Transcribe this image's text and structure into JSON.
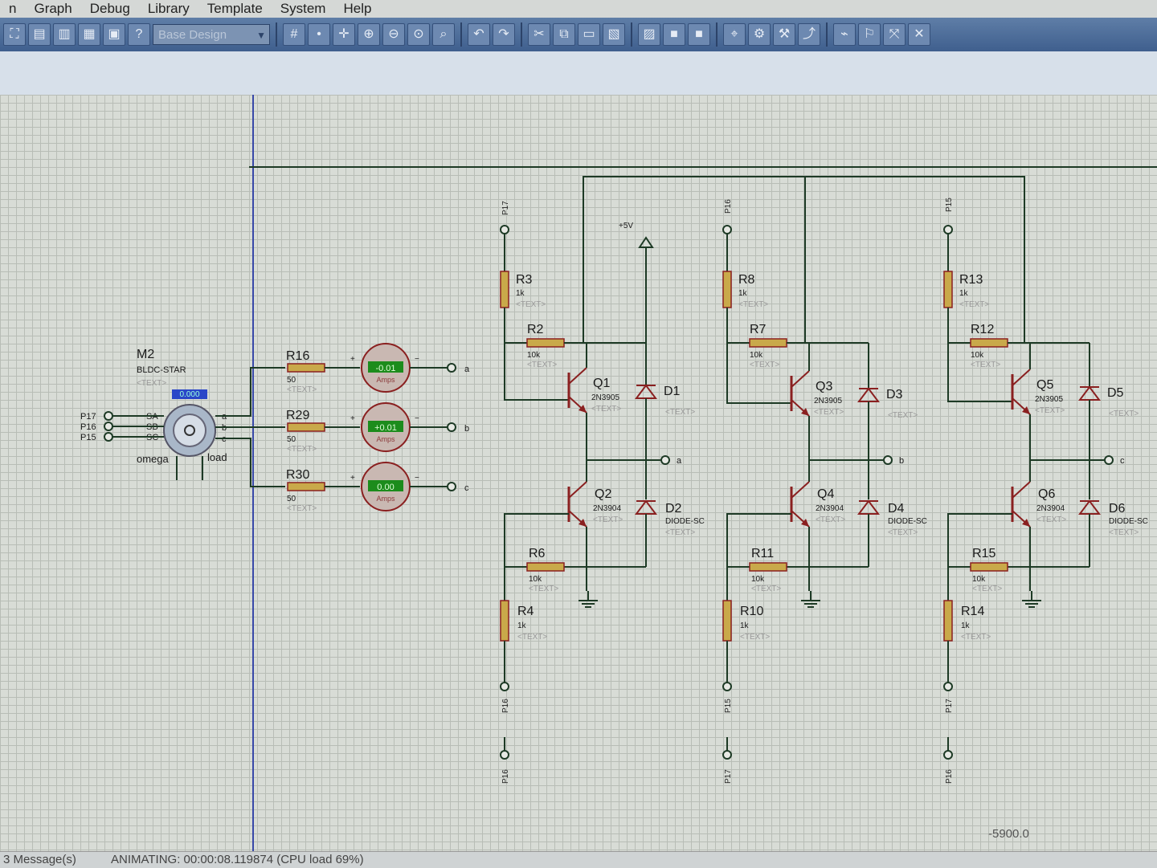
{
  "menu": [
    "n",
    "Graph",
    "Debug",
    "Library",
    "Template",
    "System",
    "Help"
  ],
  "toolbar": {
    "layer_select": "Base Design",
    "icons": [
      "zoom-to-sheet-icon",
      "new-icon",
      "open-icon",
      "save-icon",
      "print-icon",
      "help-icon",
      "grid-icon",
      "origin-icon",
      "pan-icon",
      "zoom-in-icon",
      "zoom-out-icon",
      "zoom-all-icon",
      "zoom-area-icon",
      "undo-icon",
      "redo-icon",
      "cut-icon",
      "copy-icon",
      "paste-icon",
      "block-copy-icon",
      "block-move-icon",
      "block-rotate-icon",
      "block-delete-icon",
      "pick-device-icon",
      "make-device-icon",
      "packaging-icon",
      "decompose-icon",
      "wire-autorouter-icon",
      "search-tag-icon",
      "property-assign-icon",
      "design-explorer-icon"
    ]
  },
  "motor": {
    "ref": "M2",
    "type": "BLDC-STAR",
    "text": "<TEXT>",
    "readout": "0.000",
    "pins_left": [
      "SA",
      "SB",
      "SC"
    ],
    "pins_right": [
      "a",
      "b",
      "c"
    ],
    "bottom_left": "omega",
    "bottom_right": "load",
    "inputs": [
      "P17",
      "P16",
      "P15"
    ]
  },
  "resistors_motor": [
    {
      "ref": "R16",
      "value": "50",
      "text": "<TEXT>"
    },
    {
      "ref": "R29",
      "value": "50",
      "text": "<TEXT>"
    },
    {
      "ref": "R30",
      "value": "50",
      "text": "<TEXT>"
    }
  ],
  "ammeters": [
    {
      "reading": "-0.01",
      "unit": "Amps",
      "terminal": "a"
    },
    {
      "reading": "+0.01",
      "unit": "Amps",
      "terminal": "b"
    },
    {
      "reading": "0.00",
      "unit": "Amps",
      "terminal": "c"
    }
  ],
  "supply": "+5V",
  "phases": [
    {
      "input_top": "P17",
      "r_base": "R3",
      "r_base_val": "1k",
      "r_pull": "R2",
      "r_pull_val": "10k",
      "q_high": "Q1",
      "q_high_type": "2N3905",
      "d_high": "D1",
      "out": "a",
      "q_low": "Q2",
      "q_low_type": "2N3904",
      "d_low": "D2",
      "d_type": "DIODE-SC",
      "r_low_pull": "R6",
      "r_low_pull_val": "10k",
      "r_low_base": "R4",
      "r_low_base_val": "1k",
      "input_bottom": "P16",
      "input_bottom2": "P16",
      "text": "<TEXT>"
    },
    {
      "input_top": "P16",
      "r_base": "R8",
      "r_base_val": "1k",
      "r_pull": "R7",
      "r_pull_val": "10k",
      "q_high": "Q3",
      "q_high_type": "2N3905",
      "d_high": "D3",
      "out": "b",
      "q_low": "Q4",
      "q_low_type": "2N3904",
      "d_low": "D4",
      "d_type": "DIODE-SC",
      "r_low_pull": "R11",
      "r_low_pull_val": "10k",
      "r_low_base": "R10",
      "r_low_base_val": "1k",
      "input_bottom": "P15",
      "input_bottom2": "P17",
      "text": "<TEXT>"
    },
    {
      "input_top": "P15",
      "r_base": "R13",
      "r_base_val": "1k",
      "r_pull": "R12",
      "r_pull_val": "10k",
      "q_high": "Q5",
      "q_high_type": "2N3905",
      "d_high": "D5",
      "out": "c",
      "q_low": "Q6",
      "q_low_type": "2N3904",
      "d_low": "D6",
      "d_type": "DIODE-SC",
      "r_low_pull": "R15",
      "r_low_pull_val": "10k",
      "r_low_base": "R14",
      "r_low_base_val": "1k",
      "input_bottom": "P17",
      "input_bottom2": "P16",
      "text": "<TEXT>"
    }
  ],
  "coordinate_readout": "-5900.0",
  "status": {
    "messages": "3 Message(s)",
    "animating": "ANIMATING: 00:00:08.119874 (CPU load 69%)"
  },
  "colors": {
    "wire": "#1d3a25",
    "part": "#8a2020",
    "toolbar": "#4b6a96",
    "meter_bg": "#1c8c1c"
  }
}
